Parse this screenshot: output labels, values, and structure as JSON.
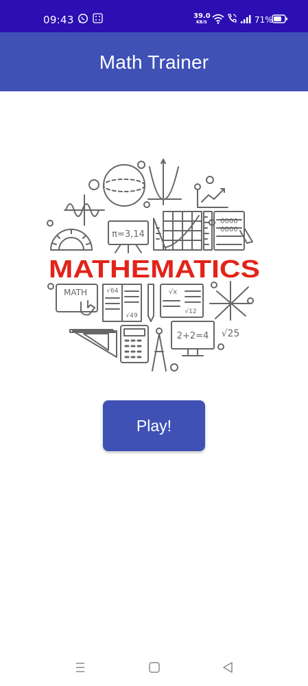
{
  "status_bar": {
    "time": "09:43",
    "net_speed_value": "39.0",
    "net_speed_unit": "KB/S",
    "battery_percent": "71%",
    "icons": [
      "whatsapp-icon",
      "notification-grid-icon",
      "wifi-icon",
      "wifi-calling-icon",
      "signal-icon",
      "battery-icon"
    ]
  },
  "app_bar": {
    "title": "Math Trainer"
  },
  "hero": {
    "word": "MATHEMATICS",
    "math_text": "MATH",
    "pi_text": "π=3,14",
    "equation_text": "2+2=4",
    "sqrt25": "√25",
    "sqrt64": "√64",
    "sqrt49": "√49",
    "sqrt12": "√12",
    "vx": "√x",
    "word_color": "#e2231a",
    "line_color": "#666666"
  },
  "play_button": {
    "label": "Play!"
  },
  "nav_bar": {
    "icons": [
      "menu-icon",
      "home-square-icon",
      "back-triangle-icon"
    ]
  },
  "colors": {
    "status_bar": "#2c0fb3",
    "app_bar": "#3f51b5",
    "button": "#3f51b5"
  }
}
